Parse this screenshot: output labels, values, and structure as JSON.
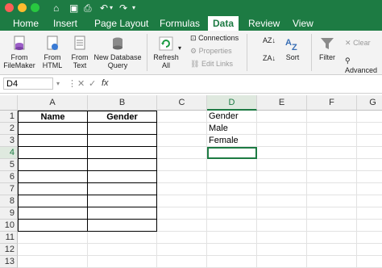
{
  "tabs": [
    "Home",
    "Insert",
    "Page Layout",
    "Formulas",
    "Data",
    "Review",
    "View"
  ],
  "active_tab": "Data",
  "ribbon": {
    "from_filemaker": [
      "From",
      "FileMaker"
    ],
    "from_html": [
      "From",
      "HTML"
    ],
    "from_text": [
      "From",
      "Text"
    ],
    "new_db_query": [
      "New Database",
      "Query"
    ],
    "refresh_all": [
      "Refresh",
      "All"
    ],
    "connections": "Connections",
    "properties": "Properties",
    "edit_links": "Edit Links",
    "sort": "Sort",
    "filter": "Filter",
    "clear": "Clear",
    "advanced": "Advanced"
  },
  "formula_bar": {
    "name_box": "D4",
    "fx": "fx",
    "formula": ""
  },
  "columns": [
    "A",
    "B",
    "C",
    "D",
    "E",
    "F",
    "G"
  ],
  "selected_column": "D",
  "selected_row": 4,
  "rows": [
    "1",
    "2",
    "3",
    "4",
    "5",
    "6",
    "7",
    "8",
    "9",
    "10",
    "11",
    "12",
    "13"
  ],
  "cells": {
    "A1": "Name",
    "B1": "Gender",
    "D1": "Gender",
    "D2": "Male",
    "D3": "Female"
  },
  "colors": {
    "excel_green": "#1d7b43",
    "selection": "#1d7b43"
  }
}
